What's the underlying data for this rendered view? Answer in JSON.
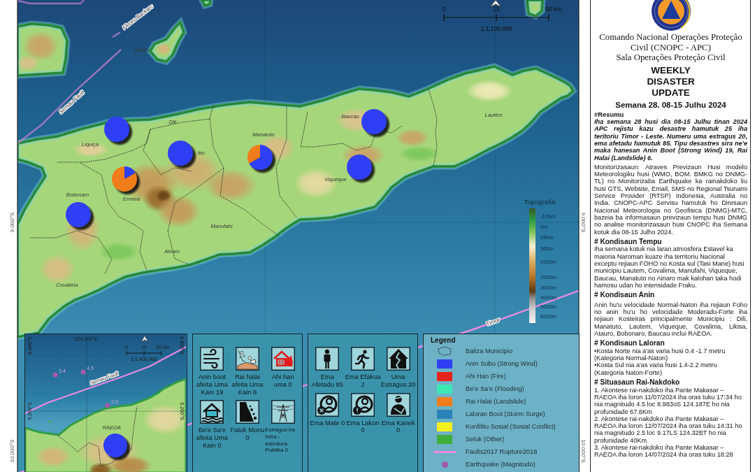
{
  "map": {
    "scale_bar": {
      "ticks": [
        "0",
        "25",
        "50 km"
      ],
      "ratio": "1:1,100,000"
    },
    "latitude_labels": {
      "left": [
        "9.000°S",
        "10.000°S"
      ],
      "right": [
        "9.000°S",
        "10.000°S"
      ]
    },
    "fault_labels": [
      "Flores Backarc",
      "Semau Fault",
      "Timor"
    ],
    "municipality_labels": [
      "Atauro",
      "Liquiçá",
      "Dili",
      "leu",
      "Manatuto",
      "Baucau",
      "Lautém",
      "Bobonaro",
      "Ermera",
      "Viqueque",
      "Manufahi",
      "Ainaro",
      "Covalima"
    ],
    "topography": {
      "title": "Topografia",
      "labels": [
        "-100m",
        "0m",
        "250m",
        "500m",
        "1000m",
        "2000m",
        "3000m",
        "4000m",
        "5000m",
        "6000m"
      ]
    }
  },
  "inset": {
    "longitude_label": "124.200°E",
    "latitude_labels": {
      "left": [
        "8.800°S",
        "9.200°S"
      ],
      "right": [
        "8.800°S",
        "9.200°S"
      ]
    },
    "scale_bar": {
      "ticks": [
        "0",
        "10",
        "20 km"
      ],
      "ratio": "1:1,400,000"
    },
    "fault_label": "Semau Fault",
    "earthquakes": [
      {
        "magnitude": "3.4"
      },
      {
        "magnitude": "4.5"
      },
      {
        "magnitude": "2.5"
      }
    ],
    "municipality_label": "RAEOA"
  },
  "hazard_stats": [
    {
      "kind": "wind",
      "caption": "Anin boot afeita Uma Kain 19"
    },
    {
      "kind": "landslide",
      "caption": "Rai halai afeita Uma Kain 6"
    },
    {
      "kind": "fire",
      "caption": "Ahi han uma 0"
    },
    {
      "kind": "flood",
      "caption": "Be'e Sa'e afeita Uma Kain 0"
    },
    {
      "kind": "rockfall",
      "caption": "Fatuk Monu 0"
    },
    {
      "kind": "infrastructure",
      "caption": "Estragus ba Infra - estrutura Publika 0"
    }
  ],
  "people_stats": [
    {
      "kind": "affected",
      "caption": "Ema Afetadu 85"
    },
    {
      "kind": "evacuated",
      "caption": "Ema Efakua 2"
    },
    {
      "kind": "damage",
      "caption": "Uma Estragus 20"
    },
    {
      "kind": "dead",
      "caption": "Ema Mate 0"
    },
    {
      "kind": "missing",
      "caption": "Ema Lakon 0"
    },
    {
      "kind": "injured",
      "caption": "Ema Kanek 0"
    }
  ],
  "legend": {
    "title": "Legend",
    "items": [
      {
        "kind": "boundary",
        "label": "Baliza Municipio"
      },
      {
        "kind": "fill",
        "label": "Anin Sobu (Strong Wind)",
        "color": "#2f3ff5"
      },
      {
        "kind": "fill",
        "label": "Ahi Han (Fire)",
        "color": "#e8231c"
      },
      {
        "kind": "fill",
        "label": "Be'e Sa'e (Flooding)",
        "color": "#3de8b4"
      },
      {
        "kind": "fill",
        "label": "Rai Halai (Landslide)",
        "color": "#f07d1a"
      },
      {
        "kind": "fill",
        "label": "Laloran Boot (Storm Surge)",
        "color": "#2b82b9"
      },
      {
        "kind": "fill",
        "label": "Konfilitu Sosial (Sosial Conflict)",
        "color": "#f4f01e"
      },
      {
        "kind": "fill",
        "label": "Seluk (Other)",
        "color": "#3fae3a"
      },
      {
        "kind": "line",
        "label": "Faults2017 Rupture2018",
        "color": "#e78be0"
      },
      {
        "kind": "point",
        "label": "Earthquake (Magnitudo)",
        "color": "#a05aa8"
      }
    ]
  },
  "report": {
    "organization": "Comando Nacional Operações Proteção Civil (CNOPC - APC)",
    "office": "Sala Operações Proteção Civil",
    "title": "WEEKLY DISASTER UPDATE",
    "week": "Semana 28. 08-15 Julhu 2024",
    "sections": [
      {
        "heading": "#Resumu",
        "paragraphs": [
          {
            "kind": "emphasis",
            "text": "Iha semana 28 husi dia 08-15 Julhu tinan 2024 APC rejistu kazu desastre hamutuk 25 iha teritoriu Timor - Leste. Numeru uma estragus 20, ema afetadu hamutuk 85. Tipu desastres sira ne'e maka hanesan Anin Boot (Strong Wind) 19, Rai Halai (Landslide) 6."
          },
          {
            "kind": "justified",
            "text": "Monitorizasaun: Atraves Previzaun Husi modelo Meteorologiku husi (WMO, BOM. BMKG no DNMG-TL) no Monitorizaba Earthquake ka rainakdoko liu husi GTS, Website, Email, SMS no Regional Tsunami Service Provider (RTSP) Indonesia, Australia no India. CNOPC-APC Servisu hamutuk ho Diresaun Nacional Meteorologia no Geofisica (DNMG)-MTC, bazeia ba informasaun previzaun tempu husi DNMG no analise monitorizasaun husi CNOPC iha Semana kotuk dia 08-15 Julho 2024."
          }
        ]
      },
      {
        "heading": "# Kondisaun Tempu",
        "paragraphs": [
          {
            "kind": "plain",
            "text": "Iha semana kotuk nia laran atmosfera Estavel ka maioria Naroman kuaze iha territoriu Nacional exceptu rejiaun FOHO no Kosta sul (Tasi Mane) husi municipiu Lautem, Covalima, Manufahi, Viqueque, Baucau, Manatuto no Ainaro mak kalohan taka hodi hamosu udan ho intensidade Fraku."
          }
        ]
      },
      {
        "heading": "# Kondisaun Anin",
        "paragraphs": [
          {
            "kind": "justified",
            "text": "Anin hu'u velocidade Normal-Naton iha rejiaun Foho no anin hu'u ho velocidade Moderadu-Forte iha rejiaun Kosteiras principalmente Municipiu : Dili, Manatuto, Lautem, Viqueque, Covalima, Likisa, Atauro, Bobonaro, Baucau inclui RAEOA."
          }
        ]
      },
      {
        "heading": "# Kondisaun Laloran",
        "paragraphs": [
          {
            "kind": "item",
            "text": "•Kosta Norte nia a'as varia husi 0.4 -1.7 metru (Kategoria Normal-Naton)"
          },
          {
            "kind": "item",
            "text": "•Kosta Sul nia a'as varia husi 1.4-2.2 metru (Kategoria Naton-Forte)"
          }
        ]
      },
      {
        "heading": "# Situasaun Rai-Nakdoko",
        "paragraphs": [
          {
            "kind": "item",
            "text": "1. Akontese rai-nakdoko iha Pante Makasar – RAEOA iha loron 11/07/2024 iha oras tuku 17:34 ho nia magnitudo 4.5 loc 8.983oS 124.187E ho nia profunidade 67.8Km"
          },
          {
            "kind": "item",
            "text": "2. Akontese rai-nakdoko iha Pante Makasar – RAEOA iha loron 12/07/2024 iha oras tuku 14:31 ho nia magnitudo 2.5 loc 9.17LS 124.32BT ho nia profunidade 40Km"
          },
          {
            "kind": "item",
            "text": "3. Akontese rai-nakdoko iha Pante Makasar – RAEOA iha loron 14/07/2024 iha oras tuku 18:28"
          }
        ]
      }
    ]
  }
}
